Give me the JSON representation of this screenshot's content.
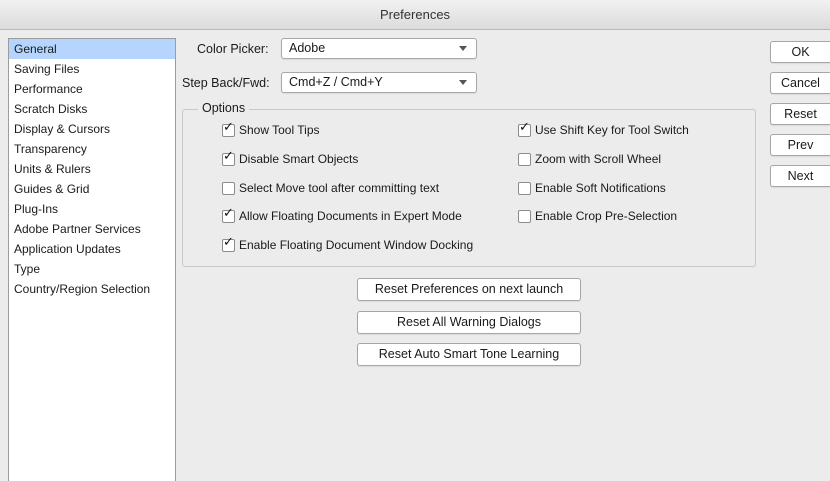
{
  "window": {
    "title": "Preferences"
  },
  "sidebar": {
    "items": [
      {
        "label": "General",
        "selected": true
      },
      {
        "label": "Saving Files"
      },
      {
        "label": "Performance"
      },
      {
        "label": "Scratch Disks"
      },
      {
        "label": "Display & Cursors"
      },
      {
        "label": "Transparency"
      },
      {
        "label": "Units & Rulers"
      },
      {
        "label": "Guides & Grid"
      },
      {
        "label": "Plug-Ins"
      },
      {
        "label": "Adobe Partner Services"
      },
      {
        "label": "Application Updates"
      },
      {
        "label": "Type"
      },
      {
        "label": "Country/Region Selection"
      }
    ]
  },
  "general": {
    "color_picker": {
      "label": "Color Picker:",
      "value": "Adobe"
    },
    "step_back": {
      "label": "Step Back/Fwd:",
      "value": "Cmd+Z / Cmd+Y"
    },
    "options_title": "Options",
    "options": [
      {
        "label": "Show Tool Tips",
        "checked": true
      },
      {
        "label": "Disable Smart Objects",
        "checked": true
      },
      {
        "label": "Select Move tool after committing text",
        "checked": false
      },
      {
        "label": "Allow Floating Documents in Expert Mode",
        "checked": true
      },
      {
        "label": "Enable Floating Document Window Docking",
        "checked": true
      },
      {
        "label": "Use Shift Key for Tool Switch",
        "checked": true
      },
      {
        "label": "Zoom with Scroll Wheel",
        "checked": false
      },
      {
        "label": "Enable Soft Notifications",
        "checked": false
      },
      {
        "label": "Enable Crop Pre-Selection",
        "checked": false
      }
    ],
    "reset_buttons": [
      {
        "label": "Reset Preferences on next launch"
      },
      {
        "label": "Reset All Warning Dialogs"
      },
      {
        "label": "Reset Auto Smart Tone Learning"
      }
    ]
  },
  "side_buttons": {
    "ok": "OK",
    "cancel": "Cancel",
    "reset": "Reset",
    "prev": "Prev",
    "next": "Next"
  },
  "colors": {
    "selection": "#b5d5ff",
    "window_bg": "#ececec"
  }
}
